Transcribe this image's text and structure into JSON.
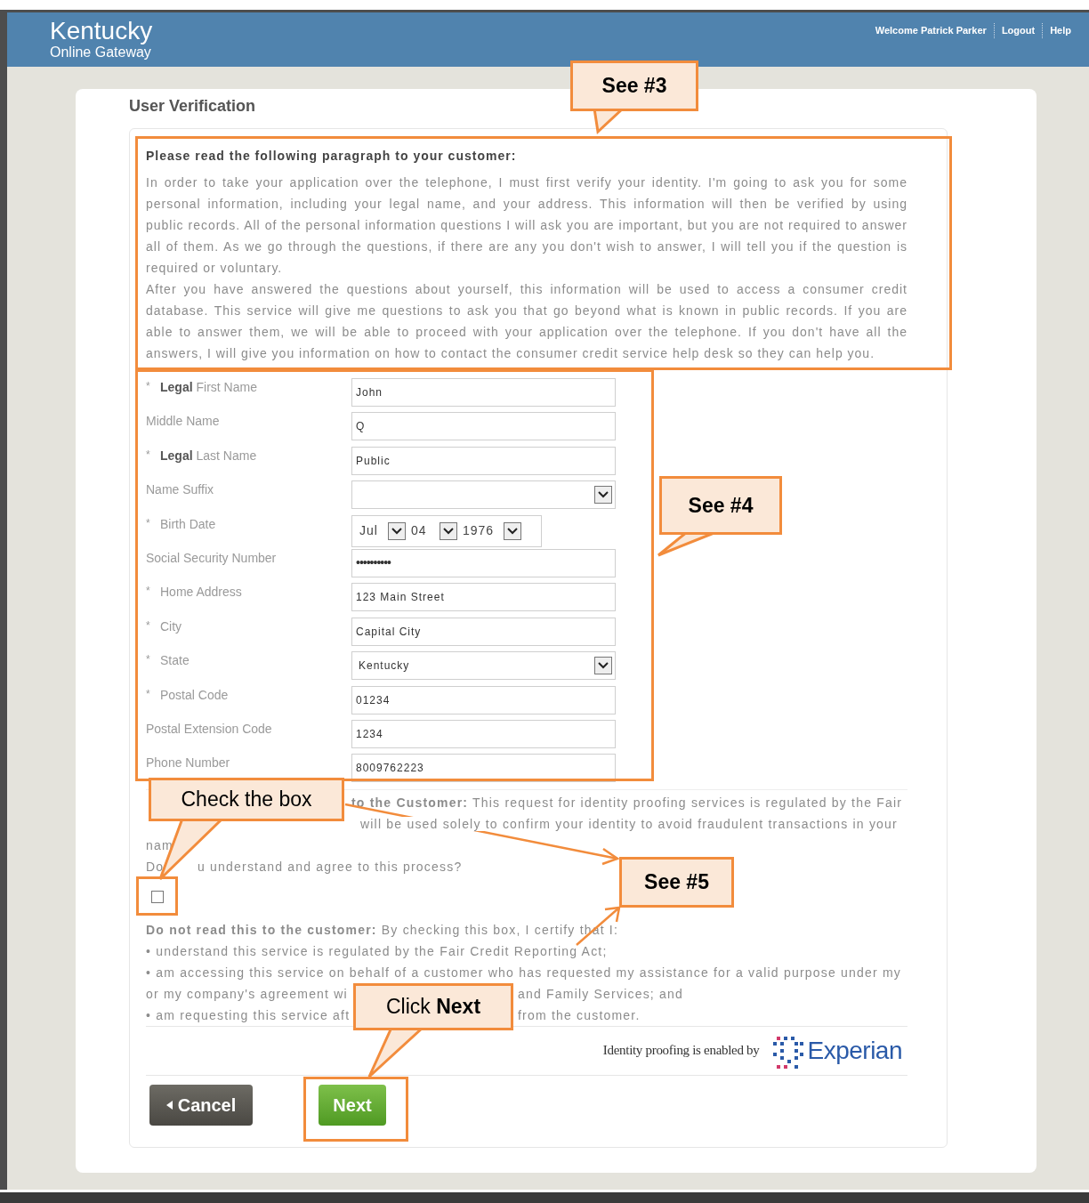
{
  "header": {
    "title": "Kentucky",
    "subtitle": "Online Gateway",
    "links": [
      "Welcome Patrick Parker",
      "Logout",
      "Help"
    ]
  },
  "page_title": "User Verification",
  "script": {
    "heading": "Please read the following paragraph to your customer:",
    "paragraphs": [
      "In order to take your application over the telephone, I must first verify your identity. I'm going to ask you for some personal information, including your legal name, and your address. This information will then be verified by using public records. All of the personal information questions I will ask you are important, but you are not required to answer all of them. As we go through the questions, if there are any you don't wish to answer, I will tell you if the question is required or voluntary.",
      "After you have answered the questions about yourself, this information will be used to access a consumer credit database. This service will give me questions to ask you that go beyond what is known in public records. If you are able to answer them, we will be able to proceed with your application over the telephone. If you don't have all the answers, I will give you information on how to contact the consumer credit service help desk so they can help you."
    ]
  },
  "fields": [
    {
      "marker": "*",
      "label": "**Legal** First Name",
      "kind": "text",
      "value": "John"
    },
    {
      "label": "Middle Name",
      "kind": "text",
      "value": "Q"
    },
    {
      "marker": "*",
      "label": "**Legal** Last Name",
      "kind": "text",
      "value": "Public"
    },
    {
      "label": "Name Suffix",
      "kind": "select"
    },
    {
      "marker": "*",
      "label": "Birth Date",
      "kind": "date",
      "parts": [
        "Jul",
        "04",
        "1976"
      ]
    },
    {
      "label": "Social Security Number",
      "kind": "password",
      "value": "••••••••••"
    },
    {
      "marker": "*",
      "label": "Home Address",
      "kind": "text",
      "value": "123 Main Street"
    },
    {
      "marker": "*",
      "label": "City",
      "kind": "text",
      "value": "Capital City"
    },
    {
      "marker": "*",
      "label": "State",
      "kind": "select",
      "value": "Kentucky"
    },
    {
      "marker": "*",
      "label": "Postal Code",
      "kind": "text",
      "value": "01234"
    },
    {
      "label": "Postal Extension Code",
      "kind": "text",
      "value": "1234"
    },
    {
      "label": "Phone Number",
      "kind": "text",
      "value": "8009762223"
    }
  ],
  "notice": {
    "lines": [
      {
        "parts": [
          "**to the Customer:** This request for identity proofing services is regulated by the Fair"
        ],
        "kind": "after-callout"
      },
      {
        "parts": [
          "will be used solely to confirm your identity to avoid fraudulent transactions in your"
        ],
        "kind": "after-callout-wide"
      },
      {
        "parts": [
          "nam"
        ],
        "kind": "plain"
      },
      {
        "parts": [
          "Do",
          "u understand and agree to this process?"
        ],
        "kind": "split"
      }
    ],
    "checked": false
  },
  "certification": {
    "lines": [
      {
        "parts": [
          "**Do not read this to the customer:** By checking this box, I certify that I:"
        ]
      },
      {
        "parts": [
          "• understand this service is regulated by the Fair Credit Reporting Act;"
        ]
      },
      {
        "parts": [
          "• am accessing this service on behalf of a customer who has requested my assistance for a valid purpose under my"
        ]
      },
      {
        "parts": [
          "or my company's agreement wi",
          "and Family Services; and"
        ]
      },
      {
        "parts": [
          "• am requesting this service aft",
          "from the customer."
        ]
      }
    ]
  },
  "provider": {
    "text": "Identity proofing is enabled by",
    "logo": "Experian"
  },
  "buttons": [
    {
      "label": "Cancel",
      "kind": "cancel"
    },
    {
      "label": "Next",
      "kind": "next"
    }
  ],
  "callouts": [
    "See #3",
    "See #4",
    "Check the box",
    "See #5",
    "Click **Next**"
  ]
}
